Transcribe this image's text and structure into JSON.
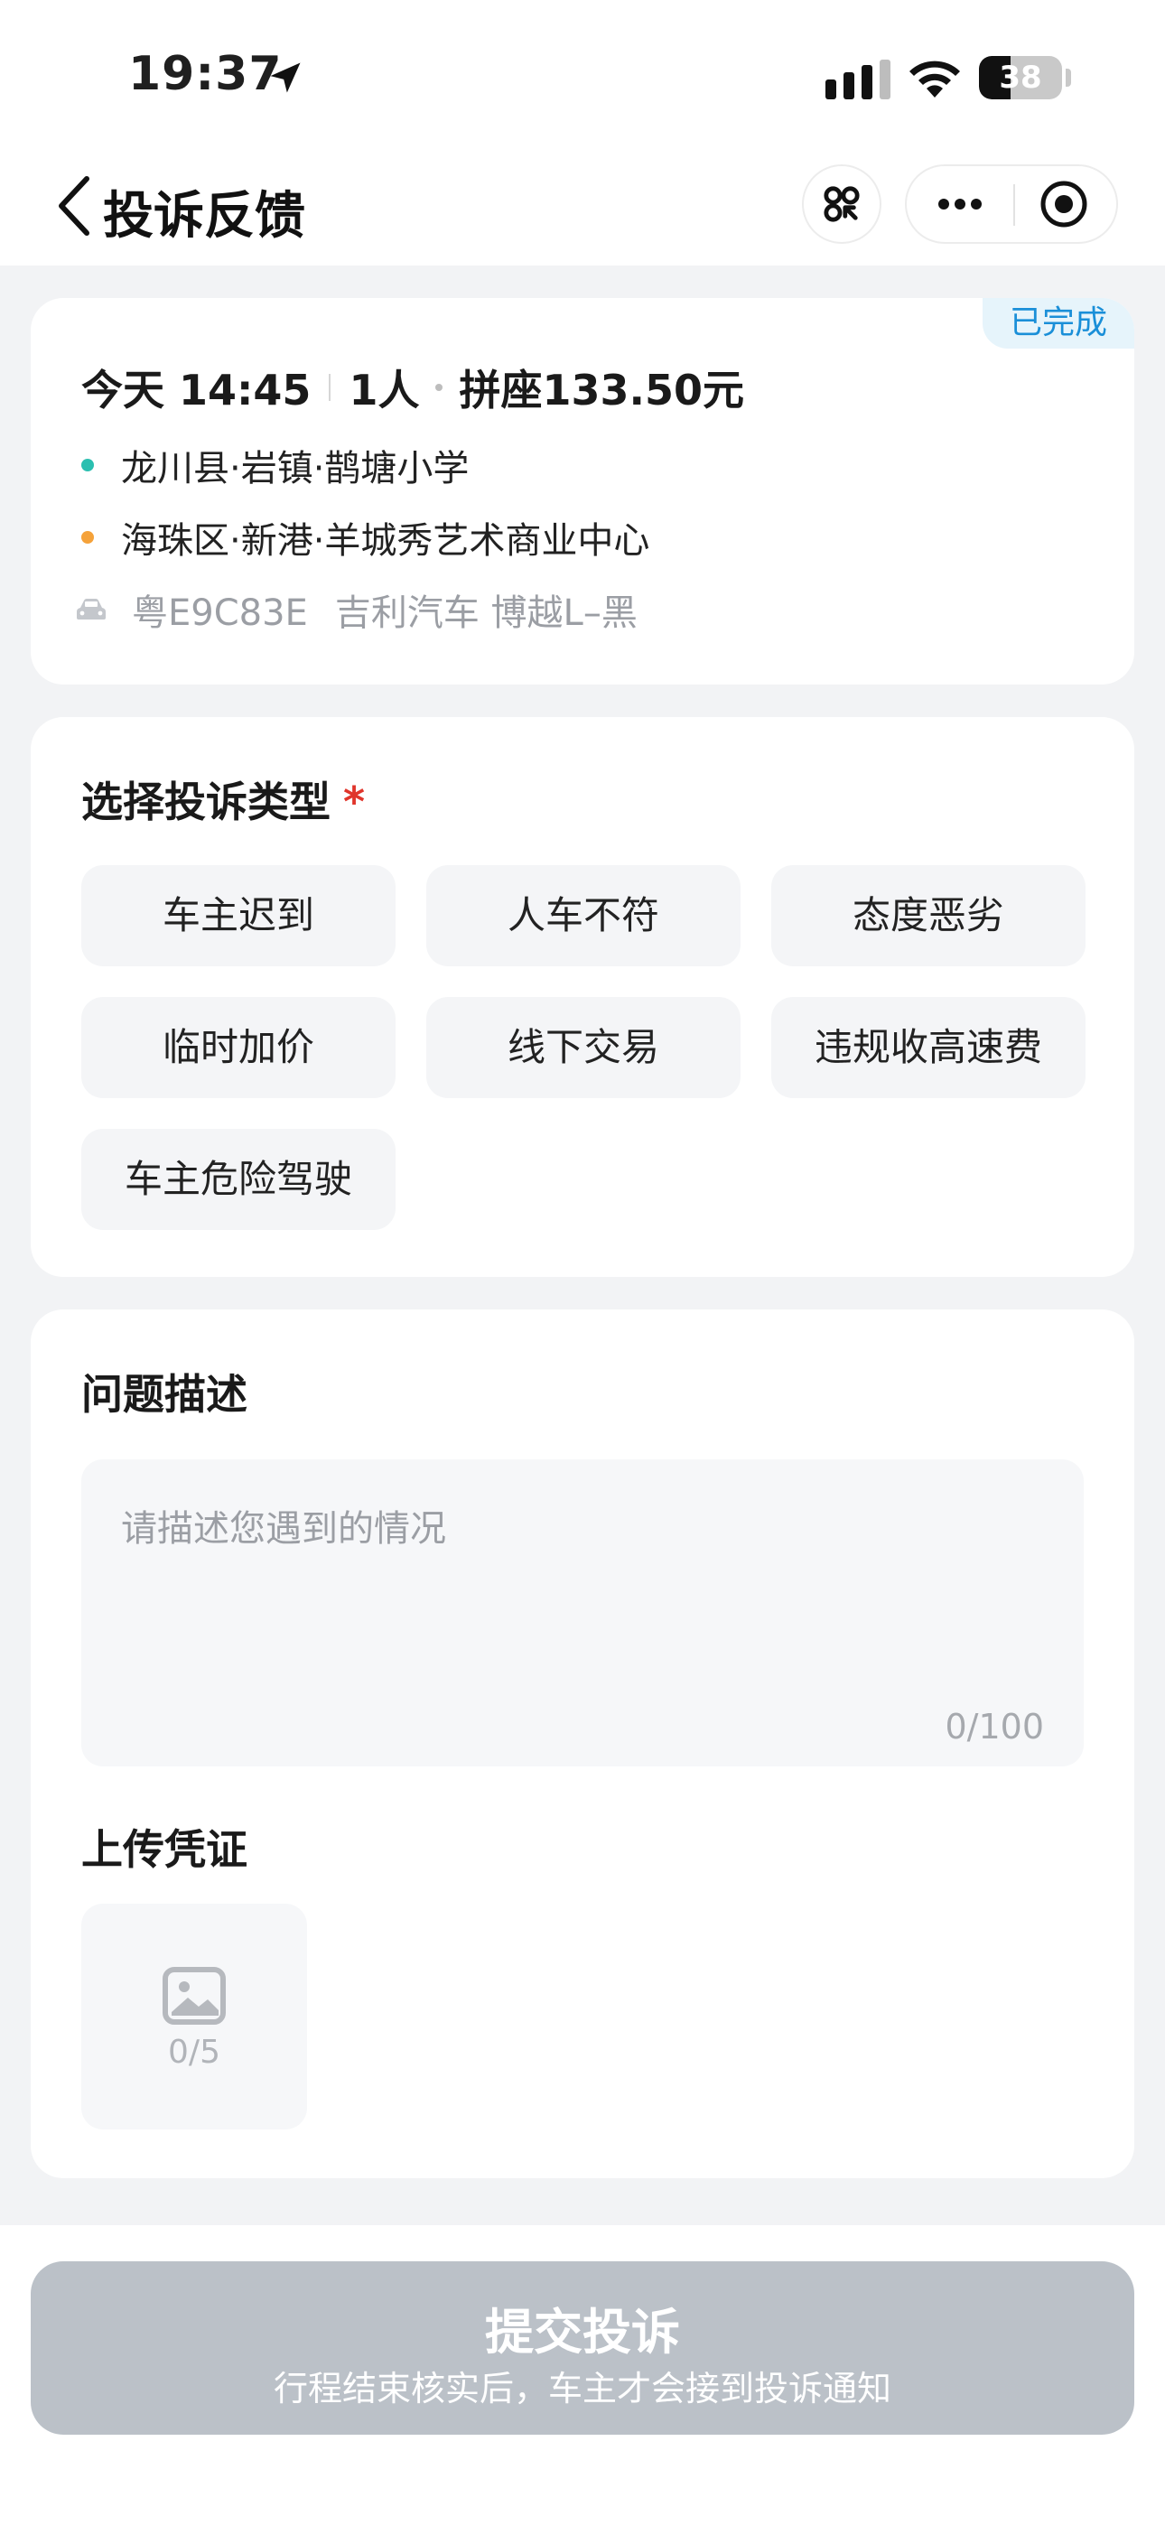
{
  "status_bar": {
    "time": "19:37",
    "battery": "38",
    "battery_level": 0.38,
    "icons": [
      "location-arrow-icon",
      "cellular-signal-icon",
      "wifi-icon",
      "battery-icon"
    ]
  },
  "nav": {
    "title": "投诉反馈",
    "icons": [
      "chevron-left-icon",
      "mini-program-switch-icon",
      "more-dots-icon",
      "target-close-icon"
    ]
  },
  "trip": {
    "status": "已完成",
    "time": "今天 14:45",
    "passengers": "1人",
    "price": "拼座133.50元",
    "start": "龙川县·岩镇·鹊塘小学",
    "end": "海珠区·新港·羊城秀艺术商业中心",
    "plate": "粤E9C83E",
    "car_model": "吉利汽车 博越L–黑",
    "colors": {
      "start_dot": "#2bbfb0",
      "end_dot": "#f5a23a",
      "badge_text": "#1a8fd8"
    }
  },
  "complaint_type": {
    "title": "选择投诉类型",
    "required_mark": "*",
    "options": [
      "车主迟到",
      "人车不符",
      "态度恶劣",
      "临时加价",
      "线下交易",
      "违规收高速费",
      "车主危险驾驶"
    ]
  },
  "description": {
    "title": "问题描述",
    "placeholder": "请描述您遇到的情况",
    "counter": "0/100"
  },
  "evidence": {
    "title": "上传凭证",
    "count": "0/5",
    "icon": "image-upload-icon"
  },
  "submit": {
    "label": "提交投诉",
    "hint": "行程结束核实后，车主才会接到投诉通知",
    "color": "#bbc1c8"
  }
}
